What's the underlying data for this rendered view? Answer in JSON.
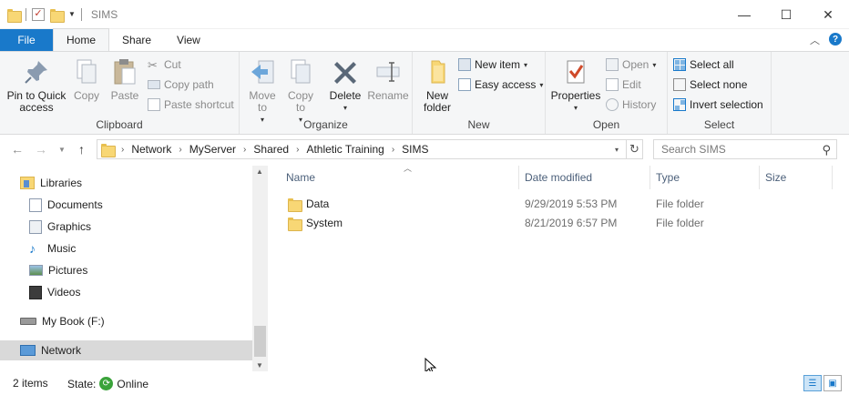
{
  "window": {
    "title": "SIMS",
    "controls": {
      "minimize": "—",
      "maximize": "☐",
      "close": "✕"
    }
  },
  "ribbon_tabs": [
    {
      "label": "File"
    },
    {
      "label": "Home"
    },
    {
      "label": "Share"
    },
    {
      "label": "View"
    }
  ],
  "ribbon": {
    "clipboard": {
      "label": "Clipboard",
      "pin_label": "Pin to Quick access",
      "copy_label": "Copy",
      "paste_label": "Paste",
      "cut_label": "Cut",
      "copy_path_label": "Copy path",
      "paste_shortcut_label": "Paste shortcut"
    },
    "organize": {
      "label": "Organize",
      "move_to_label": "Move to",
      "copy_to_label": "Copy to",
      "delete_label": "Delete",
      "rename_label": "Rename"
    },
    "new": {
      "label": "New",
      "new_folder_label": "New folder",
      "new_item_label": "New item",
      "easy_access_label": "Easy access"
    },
    "open": {
      "label": "Open",
      "properties_label": "Properties",
      "open_label": "Open",
      "edit_label": "Edit",
      "history_label": "History"
    },
    "select": {
      "label": "Select",
      "select_all_label": "Select all",
      "select_none_label": "Select none",
      "invert_label": "Invert selection"
    }
  },
  "address": {
    "breadcrumbs": [
      "Network",
      "MyServer",
      "Shared",
      "Athletic Training",
      "SIMS"
    ]
  },
  "search": {
    "placeholder": "Search SIMS"
  },
  "nav_pane": {
    "items": [
      {
        "label": "Libraries",
        "icon": "libraries-icon"
      },
      {
        "label": "Documents",
        "icon": "documents-icon"
      },
      {
        "label": "Graphics",
        "icon": "graphics-icon"
      },
      {
        "label": "Music",
        "icon": "music-icon"
      },
      {
        "label": "Pictures",
        "icon": "pictures-icon"
      },
      {
        "label": "Videos",
        "icon": "videos-icon"
      },
      {
        "label": "My Book (F:)",
        "icon": "drive-icon"
      },
      {
        "label": "Network",
        "icon": "network-icon",
        "selected": true
      }
    ]
  },
  "file_list": {
    "columns": [
      "Name",
      "Date modified",
      "Type",
      "Size"
    ],
    "rows": [
      {
        "name": "Data",
        "date": "9/29/2019 5:53 PM",
        "type": "File folder"
      },
      {
        "name": "System",
        "date": "8/21/2019 6:57 PM",
        "type": "File folder"
      }
    ]
  },
  "status": {
    "count": "2 items",
    "state_label": "State:",
    "state_value": "Online"
  },
  "colors": {
    "accent": "#1979ca",
    "folder": "#f8d775",
    "selected_nav": "#d9d9d9",
    "online": "#3aa33a"
  }
}
